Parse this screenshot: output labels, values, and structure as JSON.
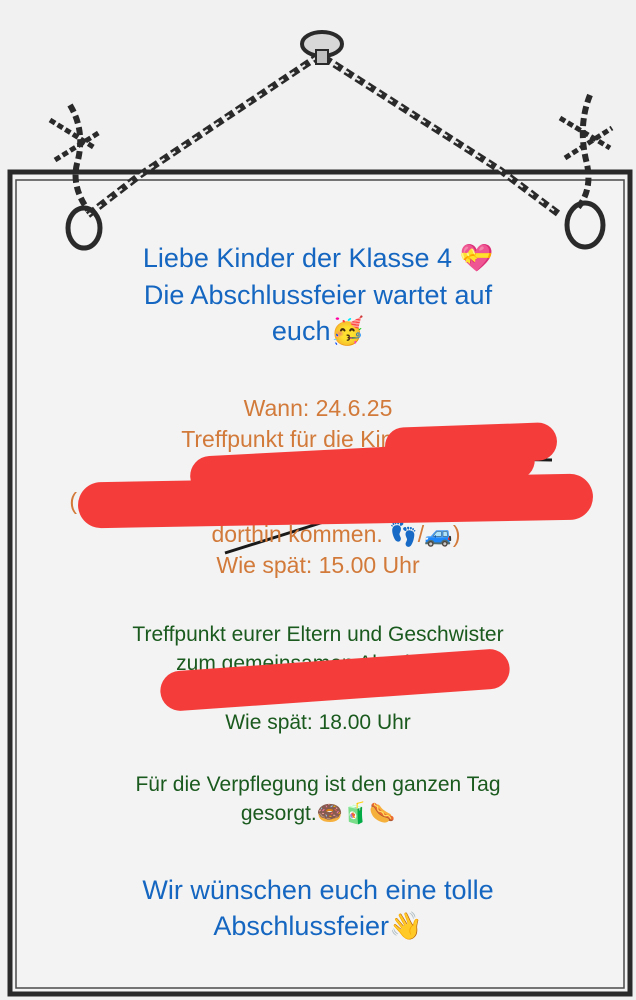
{
  "header": {
    "line1": "Liebe Kinder der Klasse 4",
    "line1_icon": "💝",
    "line2": "Die Abschlussfeier wartet auf",
    "line3": "euch",
    "line3_icon": "🥳"
  },
  "kinder": {
    "wann": "Wann: 24.6.25",
    "treffpunkt": "Treffpunkt für die Kinder: S",
    "hinweis_start": "( Bitt",
    "dorthin": "dorthin kommen. 👣/🚙)",
    "zeit": "Wie spät: 15.00 Uhr"
  },
  "eltern": {
    "line1": "Treffpunkt eurer Eltern und Geschwister",
    "line2": "zum gemeinsamen Abschluss:",
    "zeit": "Wie spät: 18.00 Uhr"
  },
  "verpflegung": {
    "line1": "Für die Verpflegung ist den ganzen Tag",
    "line2": "gesorgt.",
    "icons": "🍩🧃🌭"
  },
  "footer": {
    "line1": "Wir wünschen euch eine tolle",
    "line2": "Abschlussfeier",
    "icon": "👋"
  },
  "colors": {
    "blue_text": "#1466c0",
    "orange_text": "#d27a3a",
    "green_text": "#1a5a1e",
    "redaction": "#f43d3a",
    "sign_outline": "#2a2a2a"
  }
}
